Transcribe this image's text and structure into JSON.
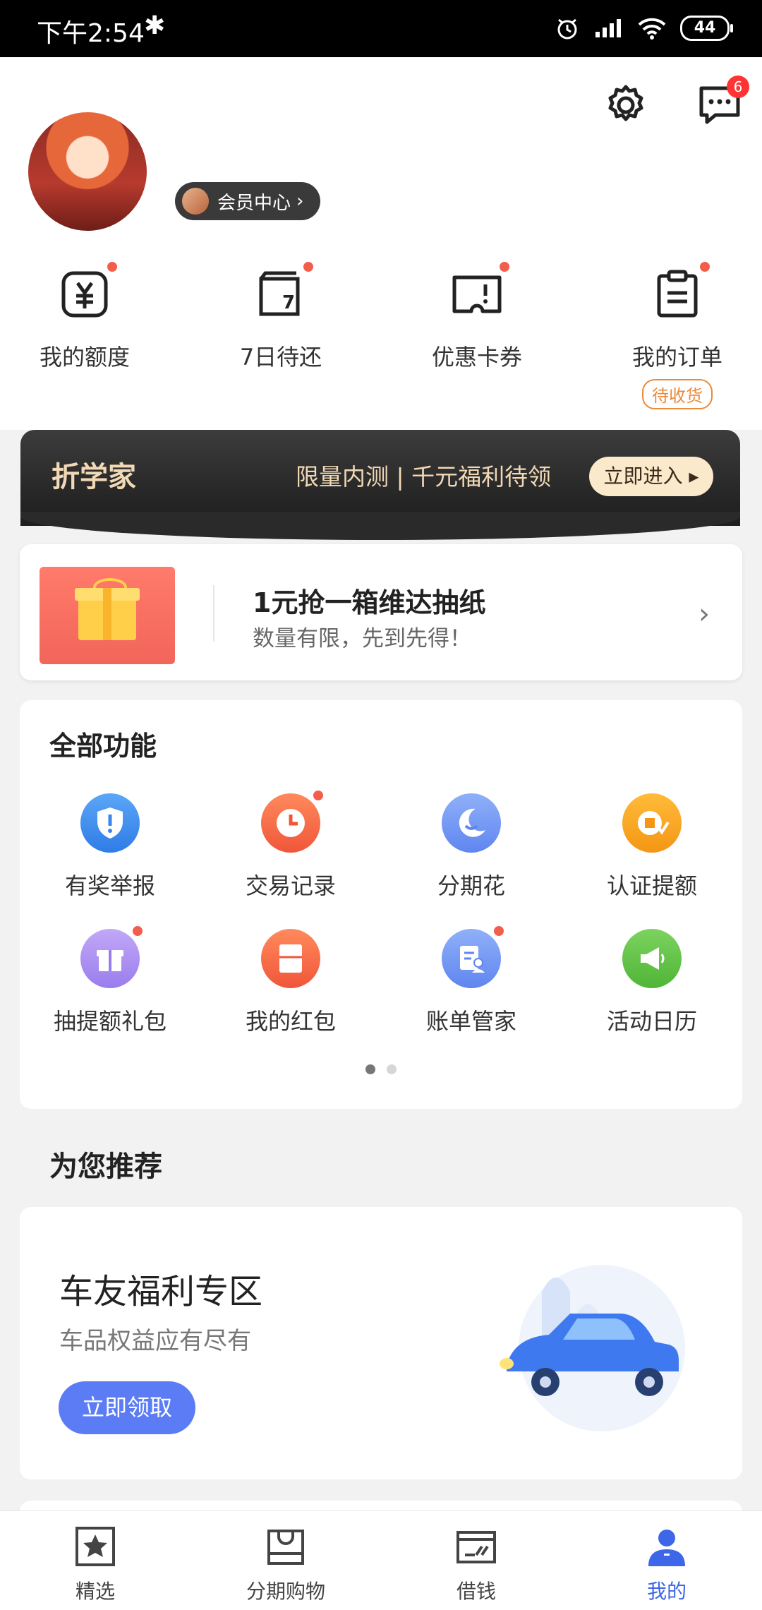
{
  "status_bar": {
    "time": "下午2:54",
    "battery": "44"
  },
  "header": {
    "member_center": "会员中心",
    "message_badge": "6"
  },
  "quick_actions": [
    {
      "label": "我的额度",
      "icon": "yuan-square-icon"
    },
    {
      "label": "7日待还",
      "icon": "calendar-7-icon"
    },
    {
      "label": "优惠卡券",
      "icon": "ticket-icon"
    },
    {
      "label": "我的订单",
      "icon": "clipboard-icon",
      "tag": "待收货"
    }
  ],
  "banner": {
    "brand": "折学家",
    "text": "限量内测 | 千元福利待领",
    "button": "立即进入"
  },
  "promo": {
    "title": "1元抢一箱维达抽纸",
    "subtitle": "数量有限，先到先得！"
  },
  "features": {
    "title": "全部功能",
    "items": [
      {
        "label": "有奖举报",
        "icon": "shield-icon",
        "color": "#3d8ef0"
      },
      {
        "label": "交易记录",
        "icon": "clock-icon",
        "color": "#f46a45"
      },
      {
        "label": "分期花",
        "icon": "moon-face-icon",
        "color": "#6a8ff2"
      },
      {
        "label": "认证提额",
        "icon": "coin-check-icon",
        "color": "#f6a21b"
      },
      {
        "label": "抽提额礼包",
        "icon": "gift-icon",
        "color": "#a98cf1"
      },
      {
        "label": "我的红包",
        "icon": "red-packet-icon",
        "color": "#f46a45"
      },
      {
        "label": "账单管家",
        "icon": "bill-user-icon",
        "color": "#6a8ff2"
      },
      {
        "label": "活动日历",
        "icon": "megaphone-icon",
        "color": "#58c241"
      }
    ]
  },
  "recommend": {
    "section_title": "为您推荐",
    "card_title": "车友福利专区",
    "card_subtitle": "车品权益应有尽有",
    "card_button": "立即领取"
  },
  "tabbar": [
    {
      "label": "精选",
      "icon": "star-square-icon"
    },
    {
      "label": "分期购物",
      "icon": "shopping-bag-icon"
    },
    {
      "label": "借钱",
      "icon": "card-icon"
    },
    {
      "label": "我的",
      "icon": "person-icon"
    }
  ],
  "colors": {
    "accent": "#3e66e8",
    "red_dot": "#f25e4b",
    "gold_text": "#f2d9b5"
  }
}
